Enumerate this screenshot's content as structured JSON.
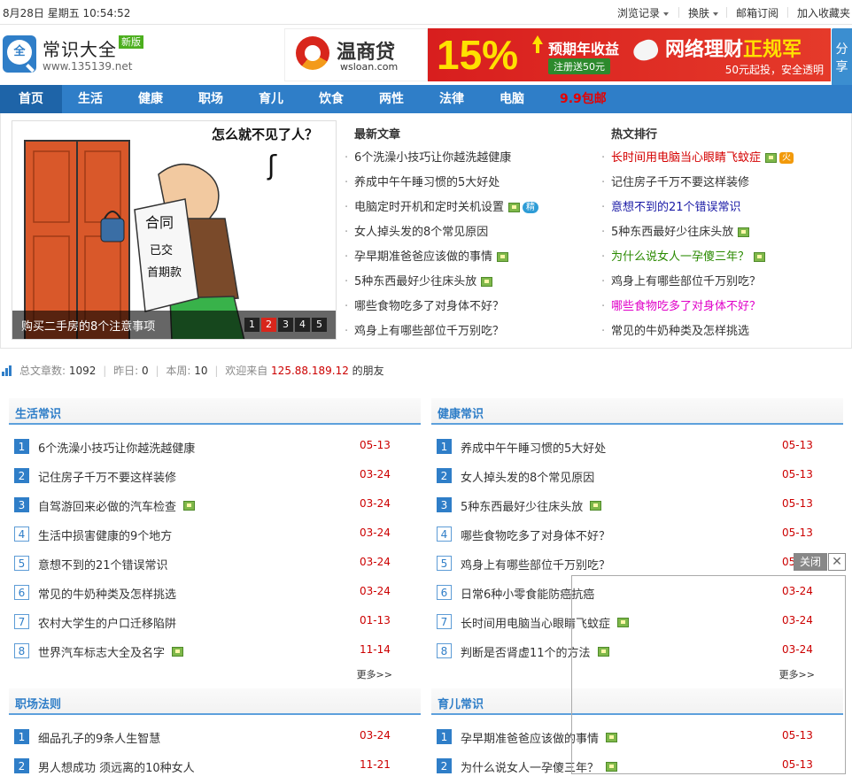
{
  "topbar": {
    "datetime": "8月28日 星期五 10:54:52",
    "history": "浏览记录",
    "skin": "换肤",
    "subscribe": "邮箱订阅",
    "favorite": "加入收藏夹"
  },
  "logo": {
    "title": "常识大全",
    "badge": "新版",
    "url": "www.135139.net",
    "icon_char": "全"
  },
  "ad": {
    "brand": "温商贷",
    "domain": "wsloan.com",
    "percent": "15%",
    "yield_label": "预期年收益",
    "gift": "注册送50元",
    "slogan_a": "网络理财",
    "slogan_b": "正规军",
    "sub": "50元起投，安全透明"
  },
  "share": "分享",
  "nav": [
    "首页",
    "生活",
    "健康",
    "职场",
    "育儿",
    "饮食",
    "两性",
    "法律",
    "电脑",
    "9.9包邮"
  ],
  "slide": {
    "caption": "购买二手房的8个注意事项",
    "pages": [
      "1",
      "2",
      "3",
      "4",
      "5"
    ],
    "active_page": "2",
    "art": {
      "speech": "怎么就不见了人？",
      "doc_title": "合同",
      "doc_l1": "已交",
      "doc_l2": "首期款"
    }
  },
  "latest": {
    "title": "最新文章",
    "items": [
      {
        "text": "6个洗澡小技巧让你越洗越健康"
      },
      {
        "text": "养成中午午睡习惯的5大好处"
      },
      {
        "text": "电脑定时开机和定时关机设置",
        "pic": true,
        "tag": "精"
      },
      {
        "text": "女人掉头发的8个常见原因"
      },
      {
        "text": "孕早期准爸爸应该做的事情",
        "pic": true
      },
      {
        "text": "5种东西最好少往床头放",
        "pic": true
      },
      {
        "text": "哪些食物吃多了对身体不好？"
      },
      {
        "text": "鸡身上有哪些部位千万别吃？"
      }
    ]
  },
  "hot": {
    "title": "热文排行",
    "items": [
      {
        "text": "长时间用电脑当心眼睛飞蚊症",
        "color": "#d40000",
        "pic": true,
        "tag": "火"
      },
      {
        "text": "记住房子千万不要这样装修",
        "color": "#333333"
      },
      {
        "text": "意想不到的21个错误常识",
        "color": "#1a1aa6"
      },
      {
        "text": "5种东西最好少往床头放",
        "color": "#333333",
        "pic": true
      },
      {
        "text": "为什么说女人一孕傻三年？",
        "color": "#2a8a00",
        "pic": true
      },
      {
        "text": "鸡身上有哪些部位千万别吃？",
        "color": "#333333"
      },
      {
        "text": "哪些食物吃多了对身体不好？",
        "color": "#e000c8"
      },
      {
        "text": "常见的牛奶种类及怎样挑选",
        "color": "#333333"
      }
    ]
  },
  "stats": {
    "total_label": "总文章数:",
    "total": "1092",
    "yesterday_label": "昨日:",
    "yesterday": "0",
    "week_label": "本周:",
    "week": "10",
    "welcome": "欢迎来自",
    "ip": "125.88.189.12",
    "friends": "的朋友"
  },
  "panels": [
    {
      "title": "生活常识",
      "more": "更多>>",
      "items": [
        {
          "text": "6个洗澡小技巧让你越洗越健康",
          "date": "05-13"
        },
        {
          "text": "记住房子千万不要这样装修",
          "date": "03-24"
        },
        {
          "text": "自驾游回来必做的汽车检查",
          "date": "03-24",
          "pic": true
        },
        {
          "text": "生活中损害健康的9个地方",
          "date": "03-24"
        },
        {
          "text": "意想不到的21个错误常识",
          "date": "03-24"
        },
        {
          "text": "常见的牛奶种类及怎样挑选",
          "date": "03-24"
        },
        {
          "text": "农村大学生的户口迁移陷阱",
          "date": "01-13"
        },
        {
          "text": "世界汽车标志大全及名字",
          "date": "11-14",
          "pic": true
        }
      ]
    },
    {
      "title": "健康常识",
      "more": "更多>>",
      "items": [
        {
          "text": "养成中午午睡习惯的5大好处",
          "date": "05-13"
        },
        {
          "text": "女人掉头发的8个常见原因",
          "date": "05-13"
        },
        {
          "text": "5种东西最好少往床头放",
          "date": "05-13",
          "pic": true
        },
        {
          "text": "哪些食物吃多了对身体不好？",
          "date": "05-13"
        },
        {
          "text": "鸡身上有哪些部位千万别吃？",
          "date": "05"
        },
        {
          "text": "日常6种小零食能防癌抗癌",
          "date": "03-24"
        },
        {
          "text": "长时间用电脑当心眼睛飞蚊症",
          "date": "03-24",
          "pic": true
        },
        {
          "text": "判断是否肾虚11个的方法",
          "date": "03-24",
          "pic": true
        }
      ]
    },
    {
      "title": "职场法则",
      "more": "",
      "items": [
        {
          "text": "细品孔子的9条人生智慧",
          "date": "03-24"
        },
        {
          "text": "男人想成功 须远离的10种女人",
          "date": "11-21"
        }
      ]
    },
    {
      "title": "育儿常识",
      "more": "",
      "items": [
        {
          "text": "孕早期准爸爸应该做的事情",
          "date": "05-13",
          "pic": true
        },
        {
          "text": "为什么说女人一孕傻三年？",
          "date": "05-13",
          "pic": true
        }
      ]
    }
  ],
  "floater": {
    "close": "关闭",
    "x": "✕"
  }
}
